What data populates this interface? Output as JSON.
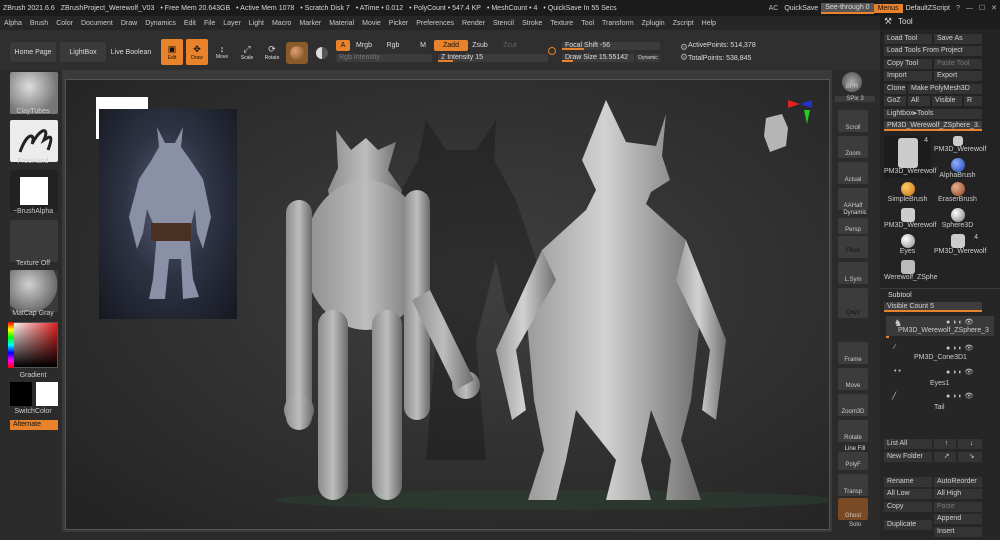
{
  "titlebar": {
    "app": "ZBrush 2021.6.6",
    "project": "ZBrushProject_Werewolf_V03",
    "free_mem": "• Free Mem 20.643GB",
    "active_mem": "• Active Mem 1078",
    "scratch": "• Scratch Disk 7",
    "atime": "• ATime • 0.012",
    "polycount": "• PolyCount • 547.4 KP",
    "meshcount": "• MeshCount • 4",
    "quicksave_timer": "• QuickSave In 55 Secs",
    "ac": "AC",
    "quicksave": "QuickSave",
    "see_through": "See-through  0",
    "menus": "Menus",
    "script": "DefaultZScript"
  },
  "menubar": [
    "Alpha",
    "Brush",
    "Color",
    "Document",
    "Draw",
    "Dynamics",
    "Edit",
    "File",
    "Layer",
    "Light",
    "Macro",
    "Marker",
    "Material",
    "Movie",
    "Picker",
    "Preferences",
    "Render",
    "Stencil",
    "Stroke",
    "Texture",
    "Tool",
    "Transform",
    "Zplugin",
    "Zscript",
    "Help"
  ],
  "toolbar": {
    "home_page": "Home Page",
    "lightbox": "LightBox",
    "live_boolean": "Live Boolean",
    "edit": "Edit",
    "draw": "Draw",
    "move": "Move",
    "scale": "Scale",
    "rotate": "Rotate",
    "a": "A",
    "mrgb": "Mrgb",
    "rgb": "Rgb",
    "m": "M",
    "zadd": "Zadd",
    "zsub": "Zsub",
    "zcut": "Zcut",
    "rgb_intensity": "Rgb Intensity",
    "z_intensity": "Z Intensity 15",
    "focal_shift": "Focal Shift -56",
    "draw_size": "Draw Size 15.55142",
    "dynamic": "Dynamic",
    "active_points": "ActivePoints: 514,378",
    "total_points": "TotalPoints: 538,845"
  },
  "leftshelf": {
    "brush": "ClayTubes",
    "stroke": "FreeHand",
    "alpha": "~BrushAlpha",
    "texture": "Texture Off",
    "material": "MatCap Gray",
    "gradient": "Gradient",
    "switchcolor": "SwitchColor",
    "alternate": "Alternate"
  },
  "rightshelf": {
    "bpr": "BPR",
    "spix": "SPix 3",
    "scroll": "Scroll",
    "zoom": "Zoom",
    "actual": "Actual",
    "aahalf": "AAHalf",
    "dynamic": "Dynamic",
    "persp": "Persp",
    "floor": "Floor",
    "lsym": "L.Sym",
    "xyz": "Qxyz",
    "frame": "Frame",
    "move": "Move",
    "zoom3d": "Zoom3D",
    "rotate": "Rotate",
    "linefill": "Line Fill",
    "polyf": "PolyF",
    "transp": "Transp",
    "ghost": "Ghost",
    "solo": "Solo"
  },
  "tool_panel": {
    "title": "Tool",
    "load_tool": "Load Tool",
    "save_as": "Save As",
    "load_from_project": "Load Tools From Project",
    "copy_tool": "Copy Tool",
    "paste_tool": "Paste Tool",
    "import": "Import",
    "export": "Export",
    "clone": "Clone",
    "make_polymesh": "Make PolyMesh3D",
    "goz": "GoZ",
    "all": "All",
    "visible": "Visible",
    "r": "R",
    "lightbox_tools": "Lightbox▸Tools",
    "current_tool": "PM3D_Werewolf_ZSphere_3. 48",
    "tools": [
      {
        "name": "PM3D_Werewolf",
        "count": "4"
      },
      {
        "name": "PM3D_Werewolf",
        "count": ""
      },
      {
        "name": "AlphaBrush",
        "count": ""
      },
      {
        "name": "SimpleBrush",
        "count": ""
      },
      {
        "name": "EraserBrush",
        "count": ""
      },
      {
        "name": "PM3D_Werewolf",
        "count": ""
      },
      {
        "name": "Sphere3D",
        "count": ""
      },
      {
        "name": "Eyes",
        "count": ""
      },
      {
        "name": "PM3D_Werewolf",
        "count": "4"
      },
      {
        "name": "Werewolf_ZSphe",
        "count": ""
      }
    ]
  },
  "subtool_panel": {
    "title": "Subtool",
    "visible_count": "Visible Count 5",
    "items": [
      "PM3D_Werewolf_ZSphere_3",
      "PM3D_Cone3D1",
      "Eyes1",
      "Tail"
    ],
    "list_all": "List All",
    "new_folder": "New Folder",
    "rename": "Rename",
    "auto_reorder": "AutoReorder",
    "all_low": "All Low",
    "all_high": "All High",
    "copy": "Copy",
    "paste": "Paste",
    "append": "Append",
    "duplicate": "Duplicate",
    "insert": "Insert"
  },
  "colors": {
    "accent": "#e8822b",
    "panel": "#2b2b2b",
    "bg": "#1b1b1b"
  }
}
